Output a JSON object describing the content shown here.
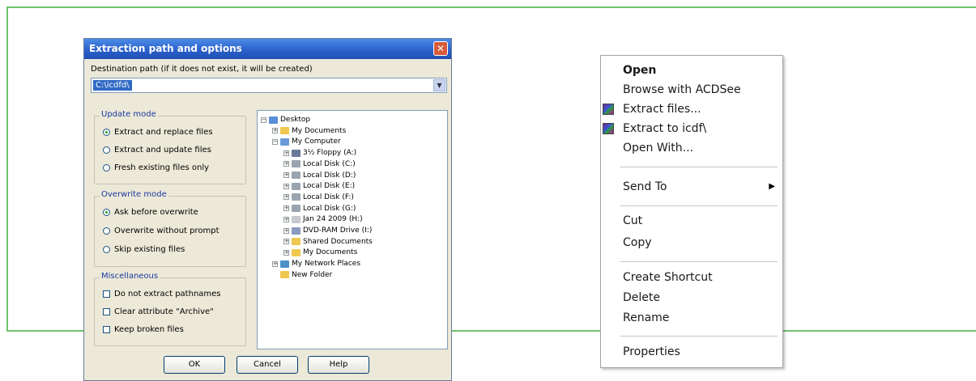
{
  "dialog": {
    "title": "Extraction path and options",
    "close_glyph": "✕",
    "destination_label": "Destination path (if it does not exist, it will be created)",
    "destination_value": "C:\\icdfd\\",
    "combo_arrow": "▼",
    "update_mode": {
      "title": "Update mode",
      "options": [
        "Extract and replace files",
        "Extract and update files",
        "Fresh existing files only"
      ],
      "selected": 0
    },
    "overwrite_mode": {
      "title": "Overwrite mode",
      "options": [
        "Ask before overwrite",
        "Overwrite without prompt",
        "Skip existing files"
      ],
      "selected": 0
    },
    "miscellaneous": {
      "title": "Miscellaneous",
      "options": [
        "Do not extract pathnames",
        "Clear attribute \"Archive\"",
        "Keep broken files"
      ]
    },
    "tree": {
      "nodes": [
        {
          "label": "Desktop",
          "expander": "−",
          "icon": "desktop-icon"
        },
        {
          "label": "My Documents",
          "expander": "+",
          "icon": "folder-icon"
        },
        {
          "label": "My Computer",
          "expander": "−",
          "icon": "computer-icon"
        },
        {
          "label": "3½ Floppy (A:)",
          "expander": "+",
          "icon": "floppy-icon"
        },
        {
          "label": "Local Disk (C:)",
          "expander": "+",
          "icon": "disk-icon"
        },
        {
          "label": "Local Disk (D:)",
          "expander": "+",
          "icon": "disk-icon"
        },
        {
          "label": "Local Disk (E:)",
          "expander": "+",
          "icon": "disk-icon"
        },
        {
          "label": "Local Disk (F:)",
          "expander": "+",
          "icon": "disk-icon"
        },
        {
          "label": "Local Disk (G:)",
          "expander": "+",
          "icon": "disk-icon"
        },
        {
          "label": "Jan 24 2009 (H:)",
          "expander": "+",
          "icon": "cd-icon"
        },
        {
          "label": "DVD-RAM Drive (I:)",
          "expander": "+",
          "icon": "dvd-icon"
        },
        {
          "label": "Shared Documents",
          "expander": "+",
          "icon": "folder-icon"
        },
        {
          "label": "My Documents",
          "expander": "+",
          "icon": "folder-icon"
        },
        {
          "label": "My Network Places",
          "expander": "+",
          "icon": "network-icon"
        },
        {
          "label": "New Folder",
          "expander": "",
          "icon": "folder-icon"
        }
      ]
    },
    "buttons": {
      "ok": "OK",
      "cancel": "Cancel",
      "help": "Help"
    }
  },
  "context_menu": {
    "items": [
      {
        "label": "Open",
        "bold": true
      },
      {
        "label": "Browse with ACDSee"
      },
      {
        "label": "Extract files...",
        "icon": "winrar-icon"
      },
      {
        "label": "Extract to icdf\\",
        "icon": "winrar-icon"
      },
      {
        "label": "Open With..."
      },
      {
        "label": "Send To",
        "submenu": true
      },
      {
        "label": "Cut"
      },
      {
        "label": "Copy"
      },
      {
        "label": "Create Shortcut"
      },
      {
        "label": "Delete"
      },
      {
        "label": "Rename"
      },
      {
        "label": "Properties"
      }
    ],
    "submenu_arrow": "▶"
  },
  "colors": {
    "frame_line": "#6fc26a",
    "selection": "#316ac5",
    "titlebar": "#2a5ec8"
  }
}
